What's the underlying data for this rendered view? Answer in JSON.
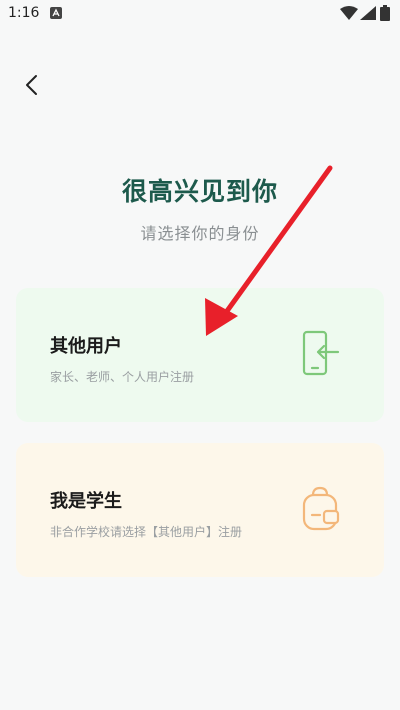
{
  "status_bar": {
    "time": "1:16"
  },
  "header": {
    "greeting": "很高兴见到你",
    "subtitle": "请选择你的身份"
  },
  "cards": [
    {
      "title": "其他用户",
      "desc": "家长、老师、个人用户注册",
      "icon": "login-phone-icon"
    },
    {
      "title": "我是学生",
      "desc": "非合作学校请选择【其他用户】注册",
      "icon": "backpack-icon"
    }
  ],
  "colors": {
    "greeting": "#1d5a4c",
    "card_other_bg": "#eefaef",
    "card_student_bg": "#fdf7ea",
    "icon_green": "#7ec87a",
    "icon_orange": "#f3b77a",
    "annotation_arrow": "#e8202a"
  }
}
